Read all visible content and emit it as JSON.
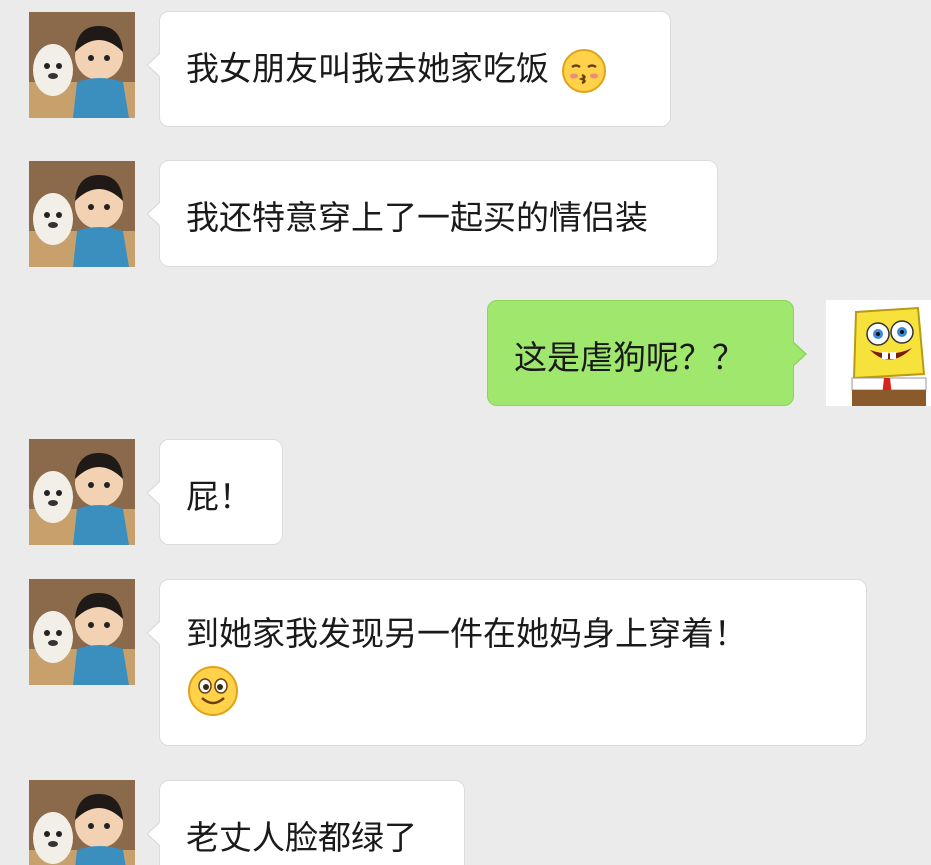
{
  "messages": [
    {
      "side": "left",
      "text": "我女朋友叫我去她家吃饭",
      "emoji": "kissing-face-icon"
    },
    {
      "side": "left",
      "text": "我还特意穿上了一起买的情侣装"
    },
    {
      "side": "right",
      "text": "这是虐狗呢？？"
    },
    {
      "side": "left",
      "text": "屁！"
    },
    {
      "side": "left",
      "text": "到她家我发现另一件在她妈身上穿着！",
      "emoji": "smiling-face-icon"
    },
    {
      "side": "left",
      "text": "老丈人脸都绿了"
    }
  ],
  "colors": {
    "background": "#ebebeb",
    "bubble_in": "#ffffff",
    "bubble_out": "#9fe86d"
  }
}
